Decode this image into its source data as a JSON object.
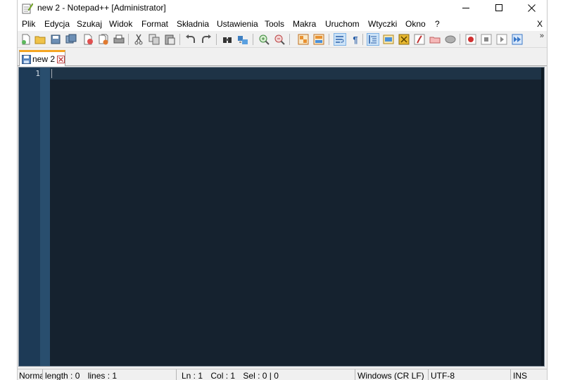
{
  "window": {
    "title": "new 2 - Notepad++ [Administrator]",
    "icons": {
      "app": "notepad-icon",
      "minimize": "minimize-icon",
      "maximize": "maximize-icon",
      "close": "close-icon"
    }
  },
  "menu": {
    "items": [
      "Plik",
      "Edycja",
      "Szukaj",
      "Widok",
      "Format",
      "Składnia",
      "Ustawienia",
      "Tools",
      "Makra",
      "Uruchom",
      "Wtyczki",
      "Okno",
      "?"
    ],
    "close_doc": "X"
  },
  "toolbar": {
    "more": "»",
    "buttons": [
      "new-file-icon",
      "open-file-icon",
      "save-icon",
      "save-all-icon",
      "close-icon",
      "close-all-icon",
      "print-icon",
      "cut-icon",
      "copy-icon",
      "paste-icon",
      "undo-icon",
      "redo-icon",
      "find-icon",
      "replace-icon",
      "zoom-in-icon",
      "zoom-out-icon",
      "sync-vertical-icon",
      "sync-horizontal-icon",
      "word-wrap-icon",
      "show-all-chars-icon",
      "indent-guide-icon",
      "user-defined-language-icon",
      "document-map-icon",
      "function-list-icon",
      "folder-as-workspace-icon",
      "monitoring-icon",
      "record-macro-icon",
      "stop-macro-icon",
      "play-macro-icon",
      "run-macro-multiple-icon"
    ]
  },
  "tabs": [
    {
      "label": "new 2",
      "icon": "save-icon",
      "close_icon": "tab-close-icon"
    }
  ],
  "editor": {
    "line_numbers": [
      "1"
    ],
    "content": "",
    "colors": {
      "background": "#15222f",
      "gutter": "#1d3a56",
      "fold_margin": "#294e6e",
      "current_line": "#1e3346"
    }
  },
  "status": {
    "doc_type": "Normal text file",
    "length": "length : 0",
    "lines": "lines : 1",
    "ln": "Ln : 1",
    "col": "Col : 1",
    "sel": "Sel : 0 | 0",
    "eol": "Windows (CR LF)",
    "encoding": "UTF-8",
    "mode": "INS"
  }
}
